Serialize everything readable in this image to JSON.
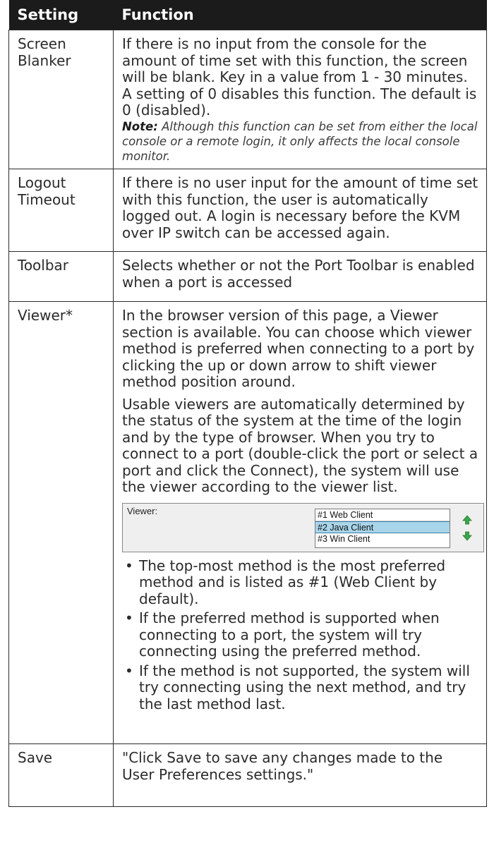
{
  "header": {
    "setting": "Setting",
    "function": "Function"
  },
  "rows": [
    {
      "setting": "Screen Blanker",
      "text": "If there is no input from the console for the amount of time set with this function, the screen will be blank. Key in a value from 1 - 30 minutes. A setting of 0 disables this function. The default is 0 (disabled).",
      "note_label": "Note:",
      "note_text": "Although this function can be set from either the local console or a remote login, it only affects the local console monitor."
    },
    {
      "setting": "Logout Timeout",
      "text": "If there is no user input for the amount of time set with this function, the user is automatically logged out. A login is necessary before the KVM over IP switch can be accessed again."
    },
    {
      "setting": "Toolbar",
      "text": "Selects whether or not the Port Toolbar is enabled when a port is accessed"
    },
    {
      "setting": "Viewer*",
      "para1": "In the browser version of this page, a Viewer section is available. You can choose which viewer method is preferred when connecting to a port by clicking the up or down arrow to shift viewer method position around.",
      "para2": "Usable viewers are automatically determined by the status of the system at the time of the login and by the type of browser. When you try to connect to a port (double-click the port or select a port and click the Connect), the system will use the viewer according to the viewer list.",
      "widget": {
        "label": "Viewer:",
        "items": [
          "#1 Web Client",
          "#2 Java Client",
          "#3 Win Client"
        ],
        "selected_index": 1,
        "arrow_color": "#3aa84a"
      },
      "bullets": [
        "The top-most method is the most preferred method and is listed as #1 (Web Client by default).",
        "If the preferred method is supported when connecting to a port, the system will try connecting using the preferred method.",
        "If the method is not supported, the system will try connecting using the next method, and try the last method last."
      ]
    },
    {
      "setting": "Save",
      "text": "\"Click Save to save any changes made to the User Preferences settings.\""
    }
  ],
  "colors": {
    "header_bg": "#1b1b1b",
    "header_text": "#ffffff",
    "border": "#2b2b2b",
    "selection": "#a9d5ea"
  }
}
